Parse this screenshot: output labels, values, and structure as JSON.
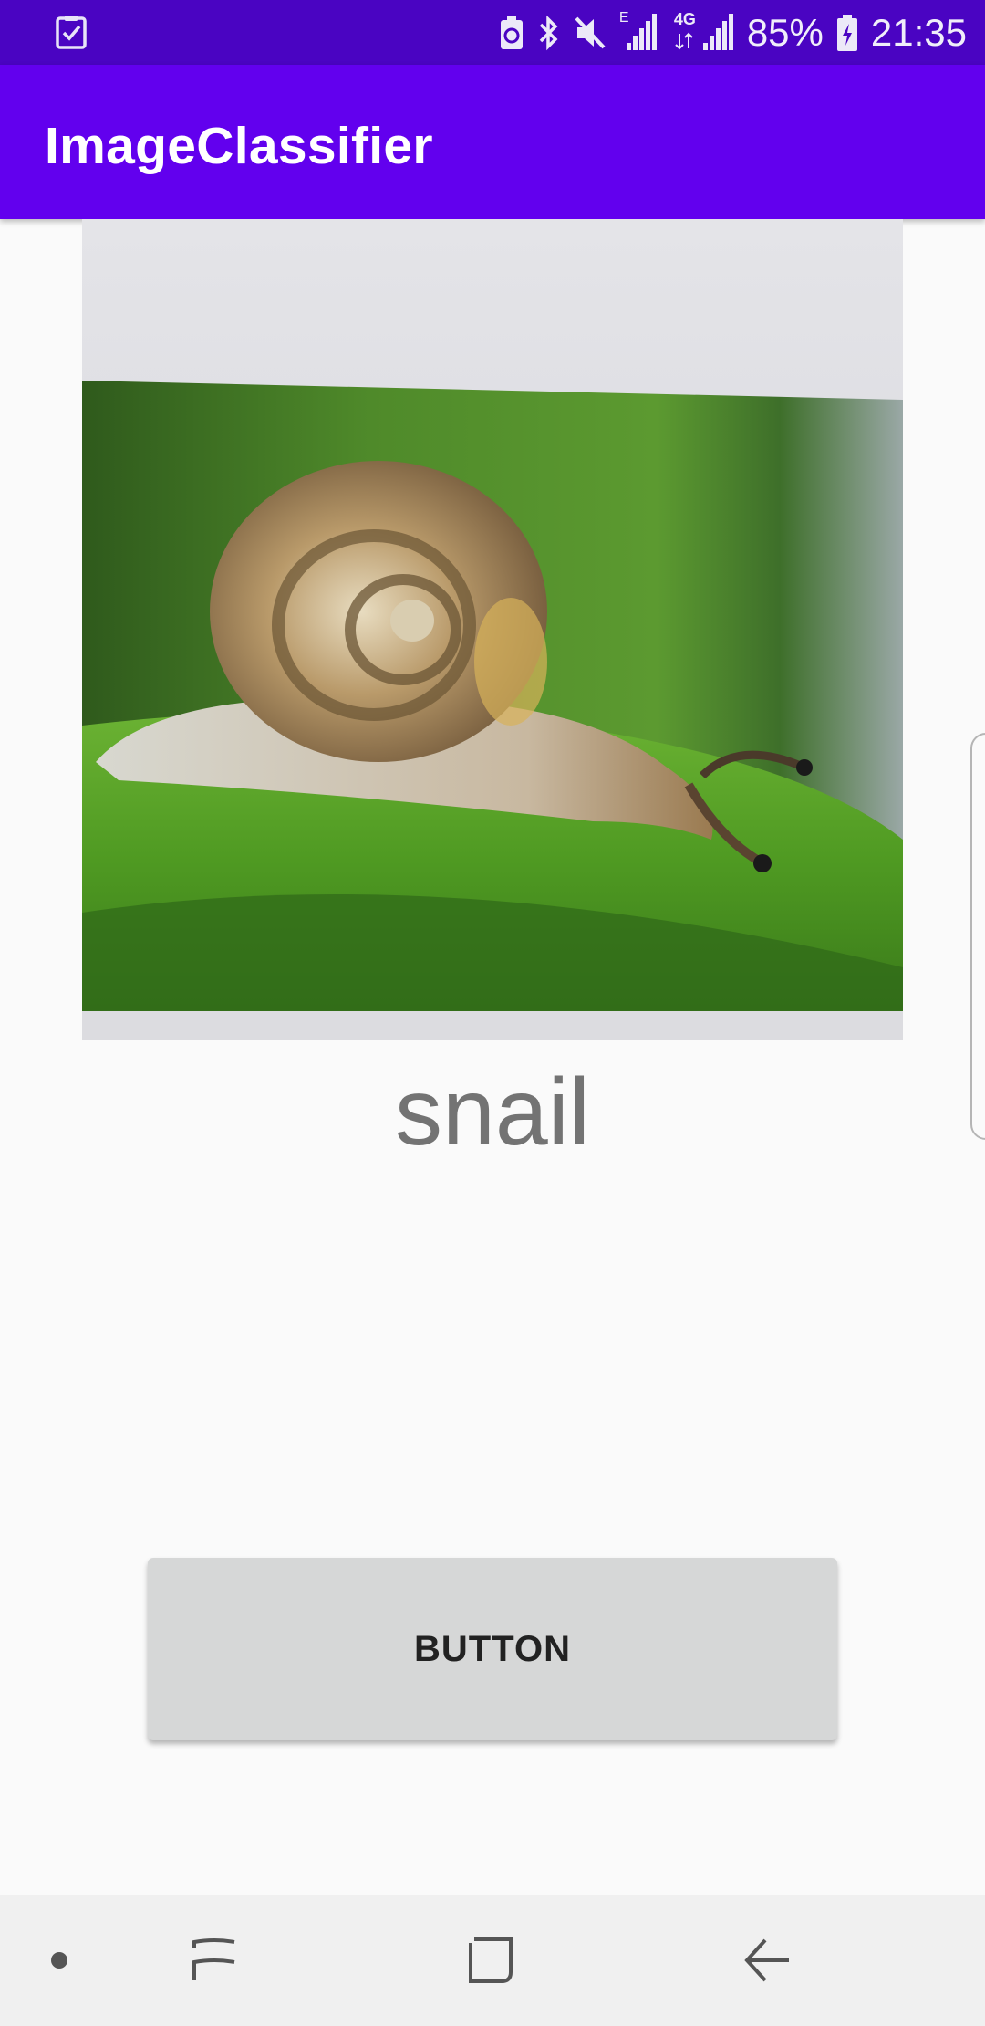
{
  "status_bar": {
    "battery_percent": "85%",
    "time": "21:35",
    "network_e": "E",
    "network_4g": "4G",
    "icons": [
      "screenshot-icon",
      "battery-saver-icon",
      "bluetooth-icon",
      "mute-icon",
      "signal-e-icon",
      "signal-4g-icon",
      "battery-charging-icon"
    ]
  },
  "app_bar": {
    "title": "ImageClassifier"
  },
  "main": {
    "image_subject": "snail photo",
    "result_label": "snail",
    "button_label": "BUTTON"
  },
  "nav_bar": {
    "icons": [
      "dot-icon",
      "recents-icon",
      "home-icon",
      "back-icon"
    ]
  },
  "colors": {
    "status_bar": "#4a04c2",
    "app_bar": "#6200ee",
    "background": "#fafafa",
    "button": "#d6d7d7",
    "label_text": "#737373"
  }
}
